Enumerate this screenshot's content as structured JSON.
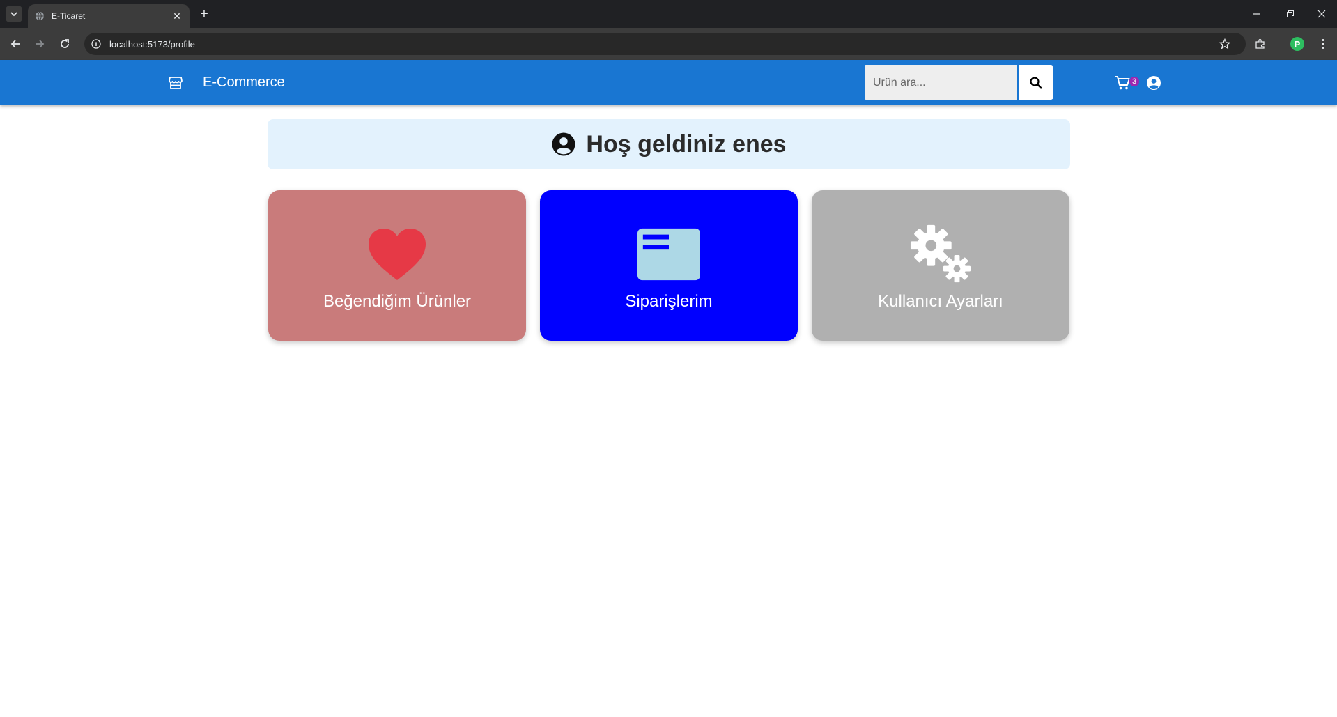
{
  "browser": {
    "tab_title": "E-Ticaret",
    "tab_close": "✕",
    "new_tab": "+",
    "url": "localhost:5173/profile",
    "profile_initial": "P"
  },
  "navbar": {
    "brand": "E-Commerce",
    "search_placeholder": "Ürün ara...",
    "cart_count": "3",
    "colors": {
      "bar": "#1976d2",
      "badge": "#9c27b0"
    }
  },
  "welcome": {
    "text": "Hoş geldiniz enes"
  },
  "cards": [
    {
      "label": "Beğendiğim Ürünler",
      "icon": "heart-icon",
      "color": "#c97b7b"
    },
    {
      "label": "Siparişlerim",
      "icon": "orders-card-icon",
      "color": "#0000ff"
    },
    {
      "label": "Kullanıcı Ayarları",
      "icon": "gears-icon",
      "color": "#b0b0b0"
    }
  ]
}
